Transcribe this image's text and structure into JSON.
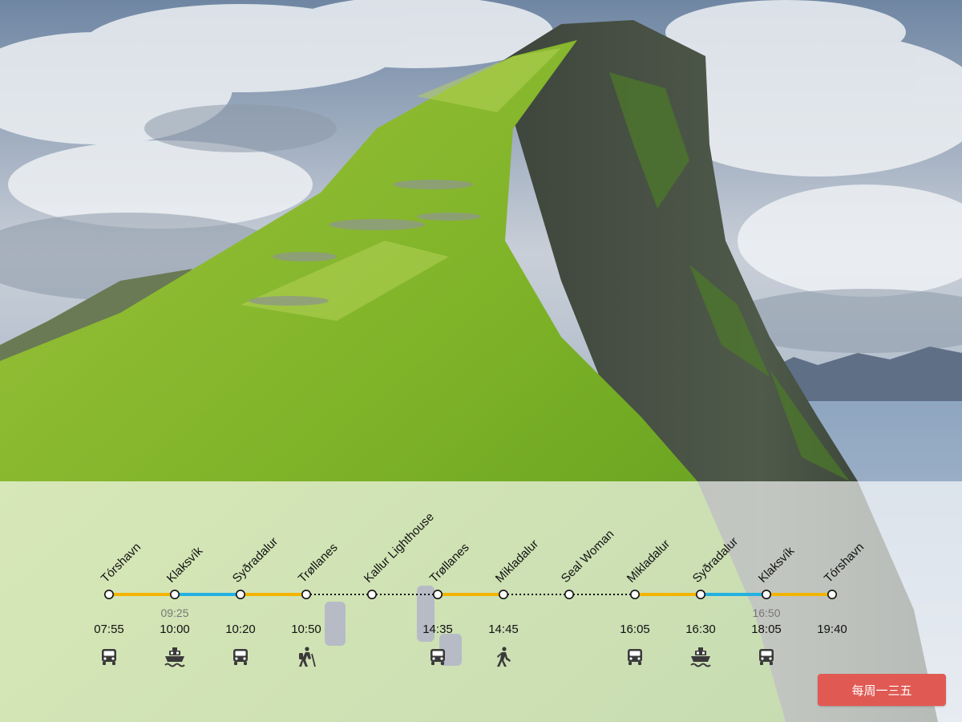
{
  "colors": {
    "bus": "#f2b400",
    "ferry": "#22b1e0",
    "walk": "#111111",
    "button": "#e05a53"
  },
  "stops": [
    {
      "name": "Tórshavn",
      "time": "07:55",
      "alt_time": "",
      "mode": "bus-icon"
    },
    {
      "name": "Klaksvík",
      "time": "10:00",
      "alt_time": "09:25",
      "mode": "ferry-icon"
    },
    {
      "name": "Syðradalur",
      "time": "10:20",
      "alt_time": "",
      "mode": "bus-icon"
    },
    {
      "name": "Trøllanes",
      "time": "10:50",
      "alt_time": "",
      "mode": "hiking-icon"
    },
    {
      "name": "Kallur Lighthouse",
      "time": "",
      "alt_time": "",
      "mode": ""
    },
    {
      "name": "Trøllanes",
      "time": "14:35",
      "alt_time": "",
      "mode": "bus-icon"
    },
    {
      "name": "Mikladalur",
      "time": "14:45",
      "alt_time": "",
      "mode": "walking-icon"
    },
    {
      "name": "Seal Woman",
      "time": "",
      "alt_time": "",
      "mode": ""
    },
    {
      "name": "Mikladalur",
      "time": "16:05",
      "alt_time": "",
      "mode": "bus-icon"
    },
    {
      "name": "Syðradalur",
      "time": "16:30",
      "alt_time": "",
      "mode": "ferry-icon"
    },
    {
      "name": "Klaksvík",
      "time": "18:05",
      "alt_time": "16:50",
      "mode": "bus-icon"
    },
    {
      "name": "Tórshavn",
      "time": "19:40",
      "alt_time": "",
      "mode": ""
    }
  ],
  "segments": [
    "bus",
    "ferry",
    "bus",
    "walk",
    "walk",
    "bus",
    "walk",
    "walk",
    "bus",
    "ferry",
    "bus"
  ],
  "schedule_button": {
    "label": "每周一三五"
  }
}
